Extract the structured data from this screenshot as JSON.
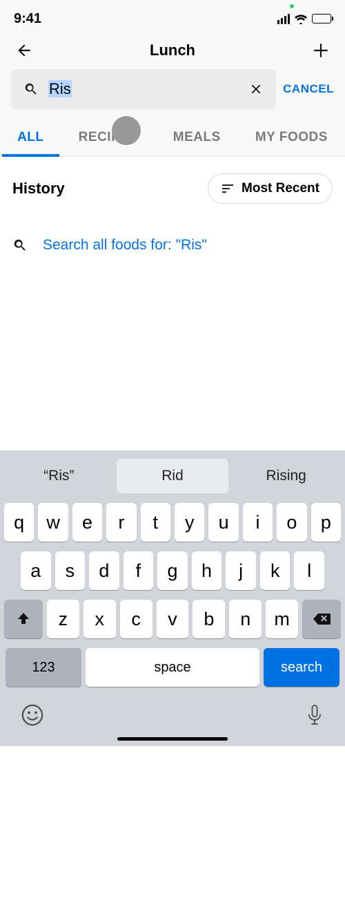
{
  "status": {
    "time": "9:41"
  },
  "nav": {
    "title": "Lunch"
  },
  "search": {
    "value": "Ris",
    "placeholder": "",
    "cancel_label": "CANCEL"
  },
  "tabs": {
    "items": [
      {
        "label": "ALL",
        "active": true
      },
      {
        "label": "RECIPES",
        "active": false
      },
      {
        "label": "MEALS",
        "active": false
      },
      {
        "label": "MY FOODS",
        "active": false
      }
    ]
  },
  "history": {
    "title": "History",
    "sort_label": "Most Recent"
  },
  "search_all": {
    "label": "Search all foods for: \"Ris\""
  },
  "keyboard": {
    "suggestions": [
      "“Ris”",
      "Rid",
      "Rising"
    ],
    "row1": [
      "q",
      "w",
      "e",
      "r",
      "t",
      "y",
      "u",
      "i",
      "o",
      "p"
    ],
    "row2": [
      "a",
      "s",
      "d",
      "f",
      "g",
      "h",
      "j",
      "k",
      "l"
    ],
    "row3": [
      "z",
      "x",
      "c",
      "v",
      "b",
      "n",
      "m"
    ],
    "key_123": "123",
    "key_space": "space",
    "key_search": "search"
  }
}
